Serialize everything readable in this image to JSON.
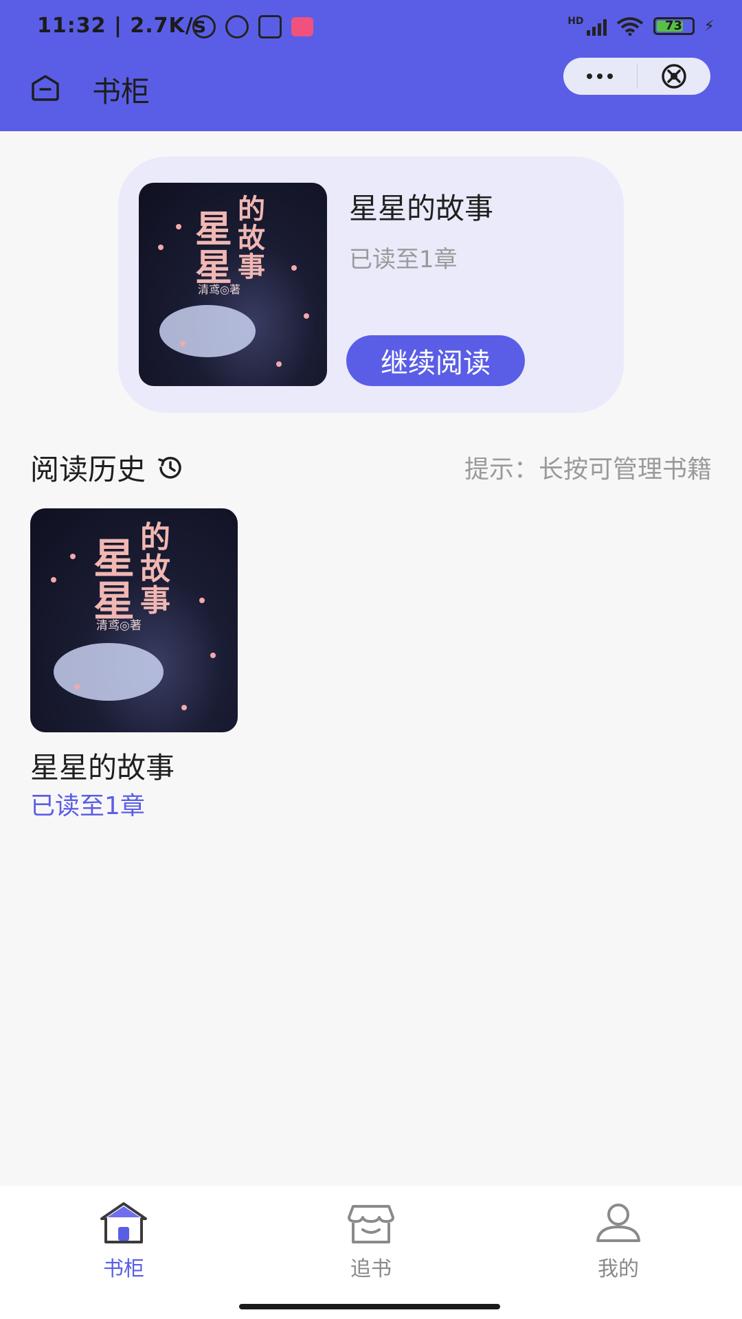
{
  "status_bar": {
    "time": "11:32 | 2.7K/s",
    "battery": "73",
    "network": "HD"
  },
  "nav": {
    "title": "书柜",
    "icons": {
      "home": "home-icon",
      "more": "more-icon",
      "close": "close-icon"
    }
  },
  "featured": {
    "title": "星星的故事",
    "progress": "已读至1章",
    "continue_label": "继续阅读",
    "cover_title_line1": "星",
    "cover_title_line2": "星",
    "cover_title_side": "的故事",
    "cover_author": "清鸢◎著"
  },
  "history": {
    "heading": "阅读历史",
    "hint": "提示：长按可管理书籍",
    "items": [
      {
        "title": "星星的故事",
        "progress": "已读至1章",
        "cover_title_line1": "星",
        "cover_title_line2": "星",
        "cover_title_side": "的故事",
        "cover_author": "清鸢◎著"
      }
    ]
  },
  "tabs": [
    {
      "label": "书柜",
      "icon": "bookshelf-icon",
      "active": true
    },
    {
      "label": "追书",
      "icon": "store-icon",
      "active": false
    },
    {
      "label": "我的",
      "icon": "user-icon",
      "active": false
    }
  ],
  "colors": {
    "accent": "#5a5ee6",
    "card_bg": "#eaeafb",
    "page_bg": "#f7f7f8"
  }
}
